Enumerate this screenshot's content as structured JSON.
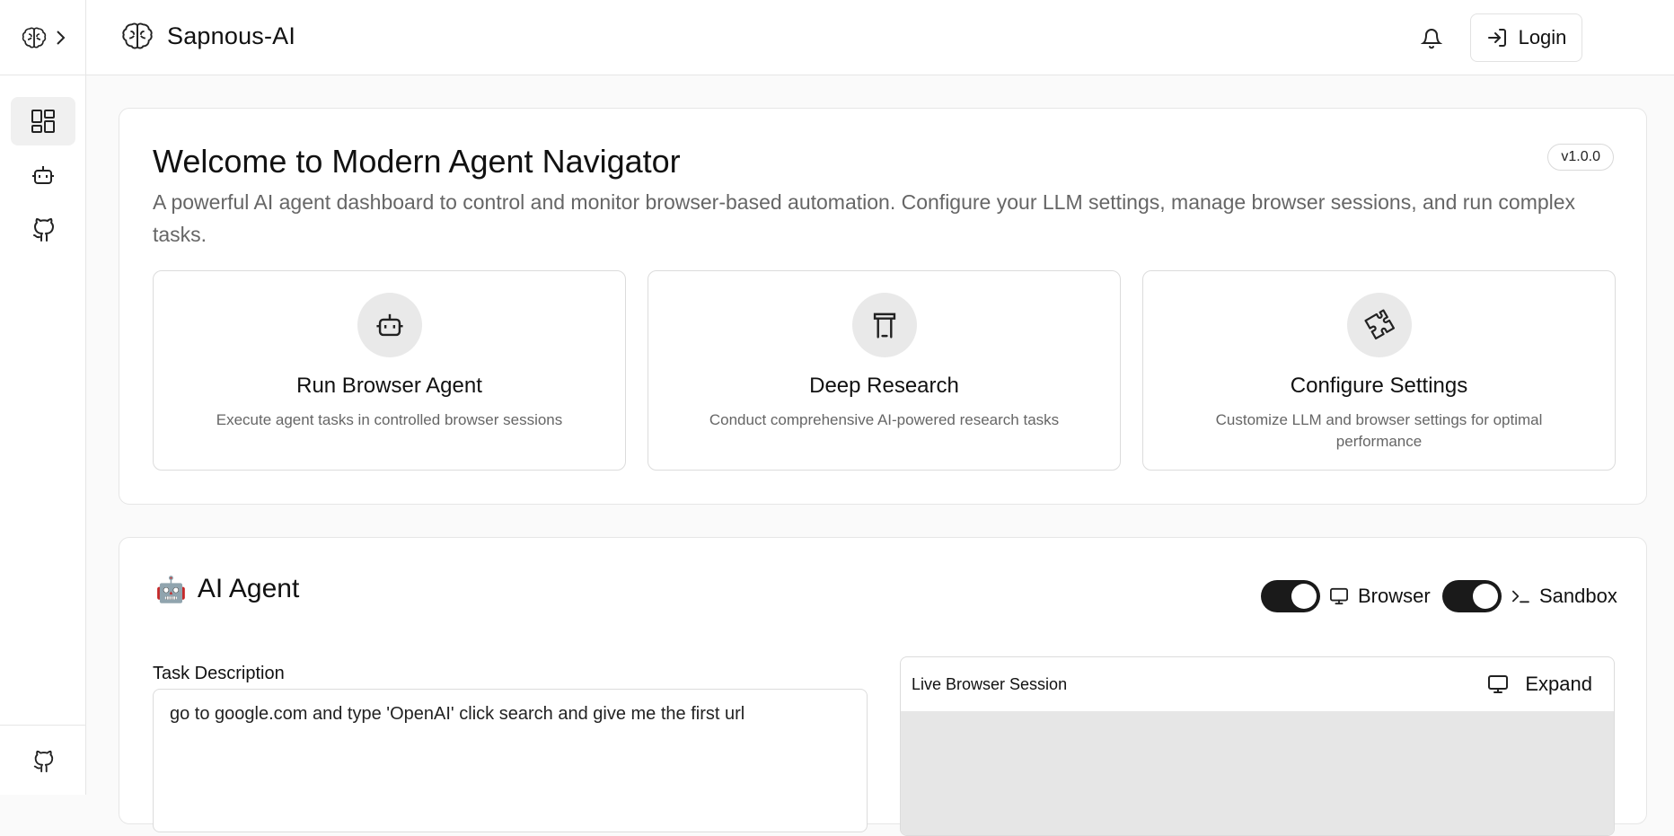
{
  "header": {
    "brand": "Sapnous-AI",
    "login_label": "Login"
  },
  "welcome": {
    "title": "Welcome to Modern Agent Navigator",
    "version": "v1.0.0",
    "description": "A powerful AI agent dashboard to control and monitor browser-based automation. Configure your LLM settings, manage browser sessions, and run complex tasks.",
    "features": [
      {
        "icon": "robot-icon",
        "title": "Run Browser Agent",
        "desc": "Execute agent tasks in controlled browser sessions"
      },
      {
        "icon": "research-icon",
        "title": "Deep Research",
        "desc": "Conduct comprehensive AI-powered research tasks"
      },
      {
        "icon": "puzzle-icon",
        "title": "Configure Settings",
        "desc": "Customize LLM and browser settings for optimal performance"
      }
    ]
  },
  "agent": {
    "emoji": "🤖",
    "title": "AI Agent",
    "toggles": [
      {
        "label": "Browser",
        "on": true,
        "icon": "monitor-icon"
      },
      {
        "label": "Sandbox",
        "on": true,
        "icon": "terminal-icon"
      }
    ],
    "task_label": "Task Description",
    "task_value": "go to google.com and type 'OpenAI' click search and give me the first url",
    "live_title": "Live Browser Session",
    "expand_label": "Expand"
  },
  "colors": {
    "accent": "#1a1a1a",
    "border": "#e6e6e6",
    "muted_text": "#666666"
  }
}
